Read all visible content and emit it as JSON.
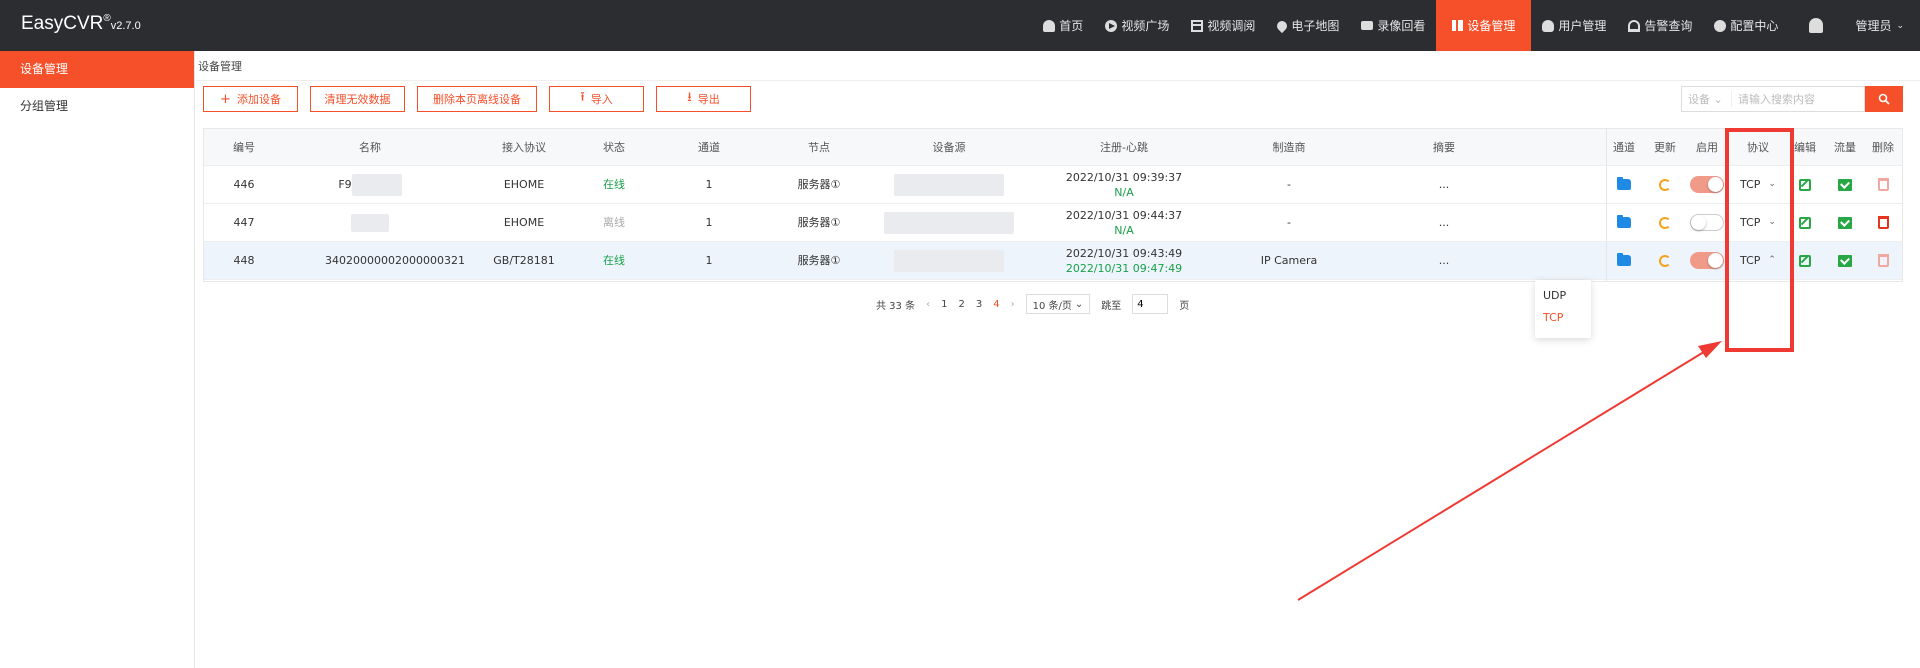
{
  "app": {
    "name": "EasyCVR",
    "reg": "®",
    "version": "v2.7.0"
  },
  "nav": [
    {
      "label": "首页",
      "icon": "home-icon",
      "active": false
    },
    {
      "label": "视频广场",
      "icon": "play-circle-icon",
      "active": false
    },
    {
      "label": "视频调阅",
      "icon": "grid-layout-icon",
      "active": false
    },
    {
      "label": "电子地图",
      "icon": "map-pin-icon",
      "active": false
    },
    {
      "label": "录像回看",
      "icon": "video-camera-icon",
      "active": false
    },
    {
      "label": "设备管理",
      "icon": "device-manage-icon",
      "active": true
    },
    {
      "label": "用户管理",
      "icon": "user-icon",
      "active": false
    },
    {
      "label": "告警查询",
      "icon": "alarm-icon",
      "active": false
    },
    {
      "label": "配置中心",
      "icon": "gear-icon",
      "active": false
    }
  ],
  "user": {
    "label": "管理员",
    "caret": "⌄"
  },
  "sidebar": {
    "items": [
      {
        "label": "设备管理",
        "active": true
      },
      {
        "label": "分组管理",
        "active": false
      }
    ]
  },
  "breadcrumb": "设备管理",
  "toolbar": {
    "add": {
      "icon": "+",
      "label": "添加设备"
    },
    "clean": {
      "label": "清理无效数据"
    },
    "delete_offline": {
      "label": "删除本页离线设备"
    },
    "import": {
      "icon": "⭱",
      "label": "导入"
    },
    "export": {
      "icon": "⭳",
      "label": "导出"
    }
  },
  "search": {
    "filter": "设备",
    "filter_caret": "⌄",
    "placeholder": "请输入搜索内容"
  },
  "table": {
    "headers": [
      "编号",
      "名称",
      "接入协议",
      "状态",
      "通道",
      "节点",
      "设备源",
      "注册-心跳",
      "制造商",
      "摘要",
      "通道",
      "更新",
      "启用",
      "协议",
      "编辑",
      "流量",
      "删除"
    ],
    "rows": [
      {
        "id": "446",
        "name": "F9",
        "protocol_access": "EHOME",
        "status": "在线",
        "channel": "1",
        "node": "服务器①",
        "register": "2022/10/31 09:39:37",
        "heartbeat": "N/A",
        "vendor": "-",
        "summary": "...",
        "enabled": true,
        "proto": "TCP",
        "proto_caret": "⌄",
        "deletable": false
      },
      {
        "id": "447",
        "name": "",
        "protocol_access": "EHOME",
        "status": "离线",
        "channel": "1",
        "node": "服务器①",
        "register": "2022/10/31 09:44:37",
        "heartbeat": "N/A",
        "vendor": "-",
        "summary": "...",
        "enabled": false,
        "proto": "TCP",
        "proto_caret": "⌄",
        "deletable": true
      },
      {
        "id": "448",
        "name": "34020000002000000321",
        "protocol_access": "GB/T28181",
        "status": "在线",
        "channel": "1",
        "node": "服务器①",
        "register": "2022/10/31 09:43:49",
        "heartbeat": "2022/10/31 09:47:49",
        "vendor": "IP Camera",
        "summary": "...",
        "enabled": true,
        "proto": "TCP",
        "proto_caret": "⌃",
        "deletable": false
      }
    ]
  },
  "pagination": {
    "total": "共 33 条",
    "prev": "‹",
    "pages": [
      "1",
      "2",
      "3",
      "4"
    ],
    "current": "4",
    "next": "›",
    "page_size": "10 条/页",
    "page_size_caret": "⌄",
    "jump_label": "跳至",
    "jump_value": "4",
    "jump_suffix": "页"
  },
  "protocol_dropdown": {
    "options": [
      "UDP",
      "TCP"
    ],
    "selected": "TCP"
  },
  "colors": {
    "accent": "#f5502a",
    "topbar": "#2b2d31",
    "online": "#19a04a",
    "annotation": "#ef3a33"
  }
}
